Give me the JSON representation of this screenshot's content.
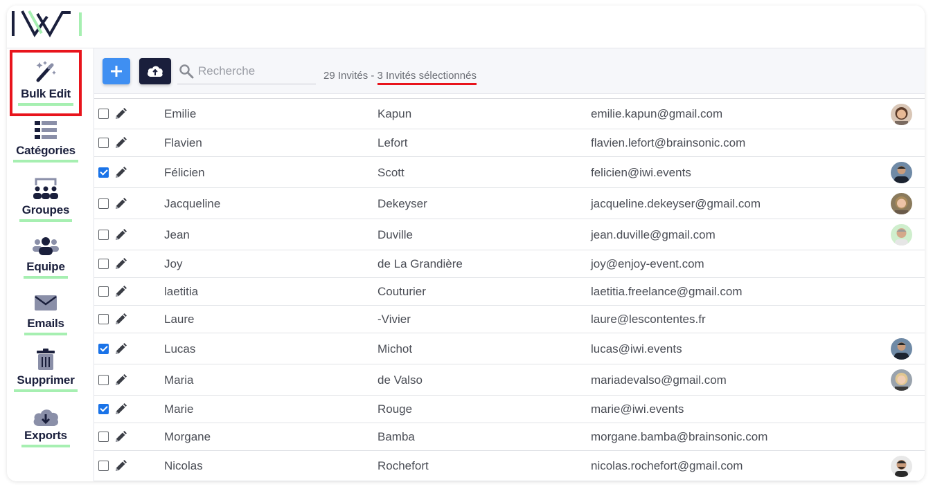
{
  "app": {
    "logo_name": "iwi-logo"
  },
  "sidebar": {
    "items": [
      {
        "label": "Bulk Edit",
        "icon": "magic-wand-icon",
        "active": true
      },
      {
        "label": "Catégories",
        "icon": "list-icon"
      },
      {
        "label": "Groupes",
        "icon": "groups-icon"
      },
      {
        "label": "Equipe",
        "icon": "team-icon"
      },
      {
        "label": "Emails",
        "icon": "envelope-icon"
      },
      {
        "label": "Supprimer",
        "icon": "trash-icon"
      },
      {
        "label": "Exports",
        "icon": "cloud-download-icon"
      }
    ]
  },
  "toolbar": {
    "add_icon": "plus-icon",
    "upload_icon": "cloud-upload-icon",
    "search_placeholder": "Recherche",
    "count_total": "29 Invités - ",
    "count_selected": "3 Invités sélectionnés"
  },
  "colors": {
    "accent_blue": "#3f8ff2",
    "navy": "#1a1f3c",
    "highlight_red": "#e8141c",
    "underline_green": "#a6efb1"
  },
  "guests": [
    {
      "first": "Emilie",
      "last": "Kapun",
      "email": "emilie.kapun@gmail.com",
      "checked": false,
      "avatar": "f1"
    },
    {
      "first": "Flavien",
      "last": "Lefort",
      "email": "flavien.lefort@brainsonic.com",
      "checked": false,
      "avatar": ""
    },
    {
      "first": "Félicien",
      "last": "Scott",
      "email": "felicien@iwi.events",
      "checked": true,
      "avatar": "m1"
    },
    {
      "first": "Jacqueline",
      "last": "Dekeyser",
      "email": "jacqueline.dekeyser@gmail.com",
      "checked": false,
      "avatar": "f2"
    },
    {
      "first": "Jean",
      "last": "Duville",
      "email": "jean.duville@gmail.com",
      "checked": false,
      "avatar": "m2"
    },
    {
      "first": "Joy",
      "last": "de La Grandière",
      "email": "joy@enjoy-event.com",
      "checked": false,
      "avatar": ""
    },
    {
      "first": "laetitia",
      "last": "Couturier",
      "email": "laetitia.freelance@gmail.com",
      "checked": false,
      "avatar": ""
    },
    {
      "first": "Laure",
      "last": "-Vivier",
      "email": "laure@lescontentes.fr",
      "checked": false,
      "avatar": ""
    },
    {
      "first": "Lucas",
      "last": "Michot",
      "email": "lucas@iwi.events",
      "checked": true,
      "avatar": "m1"
    },
    {
      "first": "Maria",
      "last": "de Valso",
      "email": "mariadevalso@gmail.com",
      "checked": false,
      "avatar": "f3"
    },
    {
      "first": "Marie",
      "last": "Rouge",
      "email": "marie@iwi.events",
      "checked": true,
      "avatar": ""
    },
    {
      "first": "Morgane",
      "last": "Bamba",
      "email": "morgane.bamba@brainsonic.com",
      "checked": false,
      "avatar": ""
    },
    {
      "first": "Nicolas",
      "last": "Rochefort",
      "email": "nicolas.rochefort@gmail.com",
      "checked": false,
      "avatar": "m3"
    }
  ]
}
